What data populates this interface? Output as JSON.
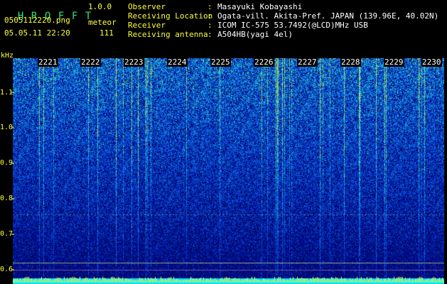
{
  "app": {
    "name_letters": [
      "H",
      "R",
      "O",
      "F",
      "F",
      "T"
    ],
    "version": "1.0.0",
    "filename": "0505112220.png",
    "datetime": "05.05.11 22:20",
    "mode_label": "meteor",
    "count": "111"
  },
  "info": [
    {
      "label": "Observer",
      "value": "Masayuki Kobayashi"
    },
    {
      "label": "Receiving Location",
      "value": "Ogata-vill. Akita-Pref. JAPAN (139.96E, 40.02N)"
    },
    {
      "label": "Receiver",
      "value": "ICOM IC-575 53.7492(@LCD)MHz USB"
    },
    {
      "label": "Receiving antenna",
      "value": "A504HB(yagi 4el)"
    }
  ],
  "axis": {
    "y_unit": "kHz",
    "y_ticks": [
      "1.1",
      "1.0",
      "0.9",
      "0.8",
      "0.7",
      "0.6"
    ],
    "x_ticks": [
      "2221",
      "2222",
      "2223",
      "2224",
      "2225",
      "2226",
      "2227",
      "2228",
      "2229",
      "2230"
    ]
  },
  "colors": {
    "background": "#000000",
    "low": "#0a1a7a",
    "mid": "#1e60d8",
    "high": "#3fd6c8",
    "peak": "#ffff3c",
    "baseline": "#00e0ff"
  }
}
